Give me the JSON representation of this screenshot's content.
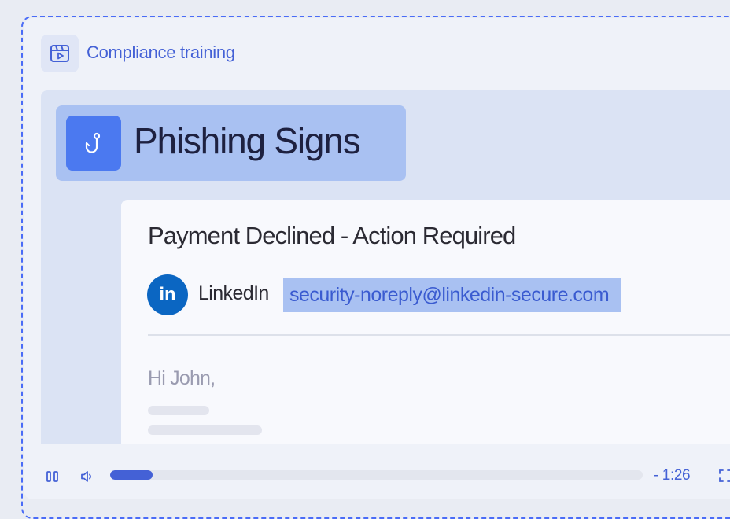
{
  "header": {
    "title": "Compliance training",
    "icon": "video-icon"
  },
  "lesson": {
    "title": "Phishing Signs",
    "icon": "fishing-hook-icon"
  },
  "email": {
    "subject": "Payment Declined - Action Required",
    "avatar_text": "in",
    "sender_name": "LinkedIn",
    "sender_email": "security-noreply@linkedin-secure.com",
    "greeting": "Hi John,"
  },
  "player": {
    "time_remaining": "- 1:26",
    "progress": 0.08,
    "pause_icon": "pause-icon",
    "volume_icon": "volume-icon",
    "fullscreen_icon": "fullscreen-icon"
  },
  "colors": {
    "accent": "#4461d6",
    "highlight": "#a9c1f2",
    "linkedin": "#0b66c2"
  }
}
